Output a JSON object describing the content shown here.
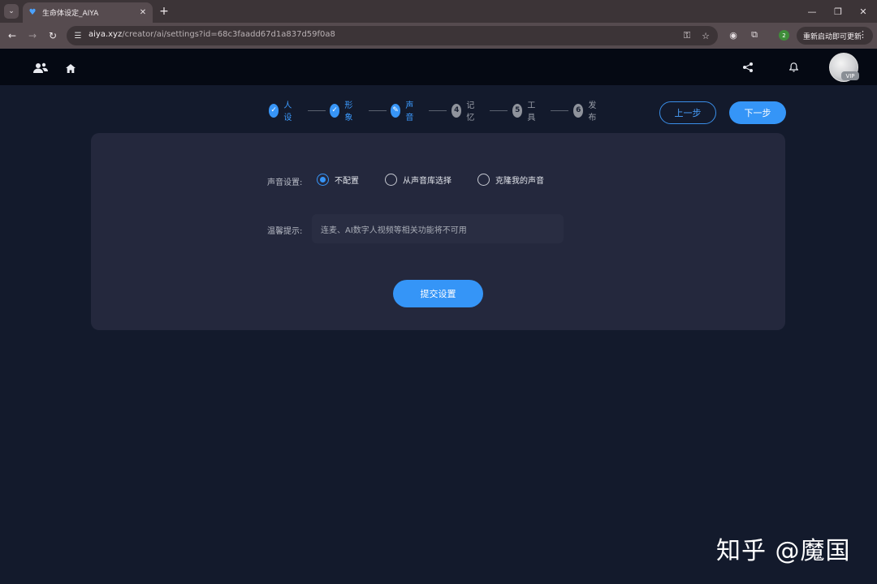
{
  "browser": {
    "tab_title": "生命体设定_AIYA",
    "url_host": "aiya.xyz",
    "url_path": "/creator/ai/settings?id=68c3faadd67d1a837d59f0a8",
    "update_button": "重新启动即可更新",
    "profile_badge": "2",
    "icons": [
      "tab-list-icon",
      "heart-favicon",
      "close-icon",
      "plus-icon",
      "minimize-icon",
      "restore-icon",
      "window-close-icon",
      "back-icon",
      "forward-icon",
      "reload-icon",
      "site-settings-icon",
      "password-key-icon",
      "star-icon",
      "extension-icon",
      "puzzle-icon",
      "more-icon"
    ]
  },
  "app": {
    "header": {
      "icons": [
        "users-icon",
        "home-icon",
        "share-icon",
        "bell-icon"
      ],
      "vip_badge": "VIP"
    },
    "steps": [
      {
        "mark": "✓",
        "label": "人设",
        "state": "done"
      },
      {
        "mark": "✓",
        "label": "形象",
        "state": "done"
      },
      {
        "mark": "✎",
        "label": "声音",
        "state": "current"
      },
      {
        "mark": "4",
        "label": "记忆",
        "state": "todo"
      },
      {
        "mark": "5",
        "label": "工具",
        "state": "todo"
      },
      {
        "mark": "6",
        "label": "发布",
        "state": "todo"
      }
    ],
    "prev_button": "上一步",
    "next_button": "下一步",
    "voice_settings": {
      "label": "声音设置:",
      "options": [
        "不配置",
        "从声音库选择",
        "克隆我的声音"
      ],
      "selected": "不配置"
    },
    "tip": {
      "label": "温馨提示:",
      "text": "连麦、AI数字人视频等相关功能将不可用"
    },
    "submit_button": "提交设置",
    "accent_color": "#3595f7"
  },
  "watermark": "知乎 @魔国"
}
